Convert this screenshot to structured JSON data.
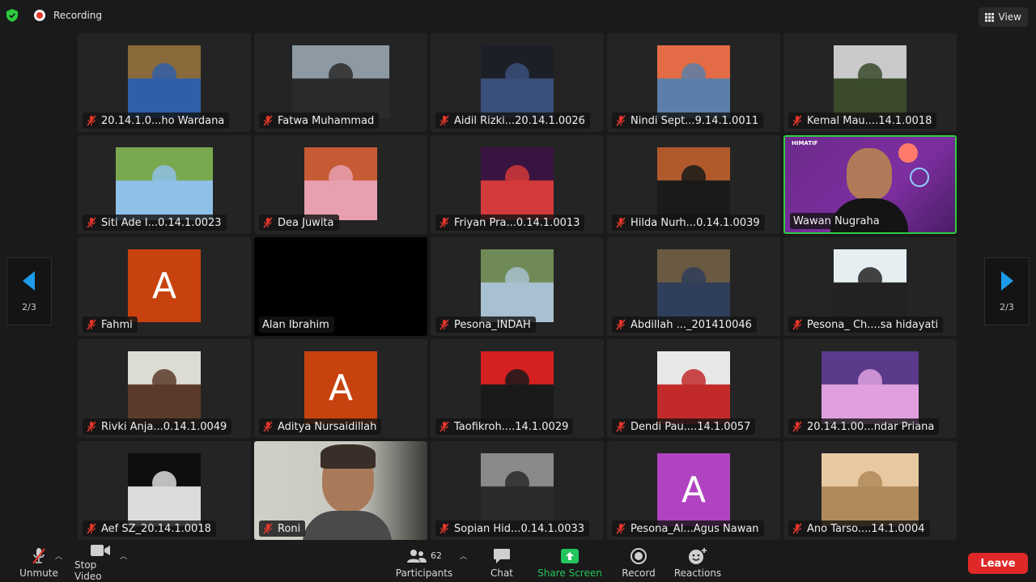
{
  "top": {
    "recording_label": "Recording",
    "view_label": "View"
  },
  "nav": {
    "left_page": "2/3",
    "right_page": "2/3"
  },
  "tiles": [
    {
      "name": "20.14.1.0...ho Wardana",
      "muted": true,
      "kind": "photo",
      "bg": "#8a6a3a",
      "accent": "#2f5fa8"
    },
    {
      "name": "Fatwa Muhammad",
      "muted": true,
      "kind": "photo",
      "bg": "#8d9aa3",
      "accent": "#2a2a2a",
      "wide": true
    },
    {
      "name": "Aidil Rizki...20.14.1.0026",
      "muted": true,
      "kind": "photo",
      "bg": "#1c1f26",
      "accent": "#3a4f7a"
    },
    {
      "name": "Nindi Sept...9.14.1.0011",
      "muted": true,
      "kind": "photo",
      "bg": "#e36b45",
      "accent": "#5b7fa8"
    },
    {
      "name": "Kemal Mau....14.1.0018",
      "muted": true,
      "kind": "photo",
      "bg": "#c9c9c9",
      "accent": "#3a4a2a"
    },
    {
      "name": "Siti Ade I...0.14.1.0023",
      "muted": true,
      "kind": "photo",
      "bg": "#7aa84e",
      "accent": "#8fc0e8",
      "wide": true
    },
    {
      "name": "Dea Juwita",
      "muted": true,
      "kind": "photo",
      "bg": "#c65a34",
      "accent": "#e8a0b0"
    },
    {
      "name": "Friyan Pra...0.14.1.0013",
      "muted": true,
      "kind": "photo",
      "bg": "#3a1440",
      "accent": "#d33a3a"
    },
    {
      "name": "Hilda Nurh...0.14.1.0039",
      "muted": true,
      "kind": "photo",
      "bg": "#b05a2c",
      "accent": "#1a1a1a"
    },
    {
      "name": "Wawan Nugraha",
      "muted": false,
      "kind": "active",
      "bg": "#6c2a8c",
      "accent": "#ff7a6a",
      "brand": "HIMATIF"
    },
    {
      "name": "Fahmi",
      "muted": true,
      "kind": "avatar",
      "letter": "A",
      "bg": "#c8420f"
    },
    {
      "name": "Alan Ibrahim",
      "muted": false,
      "kind": "black"
    },
    {
      "name": "Pesona_INDAH",
      "muted": true,
      "kind": "photo",
      "bg": "#6f8a56",
      "accent": "#a8c0d0"
    },
    {
      "name": "Abdillah ..._201410046",
      "muted": true,
      "kind": "photo",
      "bg": "#6a5a42",
      "accent": "#2f3e5a"
    },
    {
      "name": "Pesona_ Ch....sa hidayati",
      "muted": true,
      "kind": "photo",
      "bg": "#e6eef2",
      "accent": "#222222"
    },
    {
      "name": "Rivki Anja...0.14.1.0049",
      "muted": true,
      "kind": "photo",
      "bg": "#dcdcd2",
      "accent": "#5a3a2a"
    },
    {
      "name": "Aditya Nursaidillah",
      "muted": true,
      "kind": "avatar",
      "letter": "A",
      "bg": "#c8420f"
    },
    {
      "name": "Taofikroh....14.1.0029",
      "muted": true,
      "kind": "photo",
      "bg": "#d42020",
      "accent": "#1a1a1a"
    },
    {
      "name": "Dendi Pau....14.1.0057",
      "muted": true,
      "kind": "photo",
      "bg": "#e8e8e8",
      "accent": "#c22a2a"
    },
    {
      "name": "20.14.1.00...ndar Priana",
      "muted": true,
      "kind": "photo",
      "bg": "#5a3a8a",
      "accent": "#e0a0e0",
      "wide": true
    },
    {
      "name": "Aef SZ_20.14.1.0018",
      "muted": true,
      "kind": "photo",
      "bg": "#0e0e0e",
      "accent": "#dcdcdc"
    },
    {
      "name": "Roni",
      "muted": true,
      "kind": "fullvideo",
      "bg": "#c8c8c0",
      "accent": "#3a2e28"
    },
    {
      "name": "Sopian Hid...0.14.1.0033",
      "muted": true,
      "kind": "photo",
      "bg": "#8a8a8a",
      "accent": "#2a2a2a"
    },
    {
      "name": "Pesona_Al...Agus Nawan",
      "muted": true,
      "kind": "avatar",
      "letter": "A",
      "bg": "#b044c0"
    },
    {
      "name": "Ano Tarso....14.1.0004",
      "muted": true,
      "kind": "photo",
      "bg": "#e8c8a0",
      "accent": "#b08a5a",
      "wide": true
    }
  ],
  "toolbar": {
    "unmute": "Unmute",
    "stop_video": "Stop Video",
    "participants": "Participants",
    "participant_count": "62",
    "chat": "Chat",
    "share_screen": "Share Screen",
    "record": "Record",
    "reactions": "Reactions",
    "leave": "Leave"
  },
  "colors": {
    "active_border": "#2ecc40",
    "share_green": "#22c55e",
    "leave_red": "#e02828",
    "muted_red": "#e5362b"
  }
}
